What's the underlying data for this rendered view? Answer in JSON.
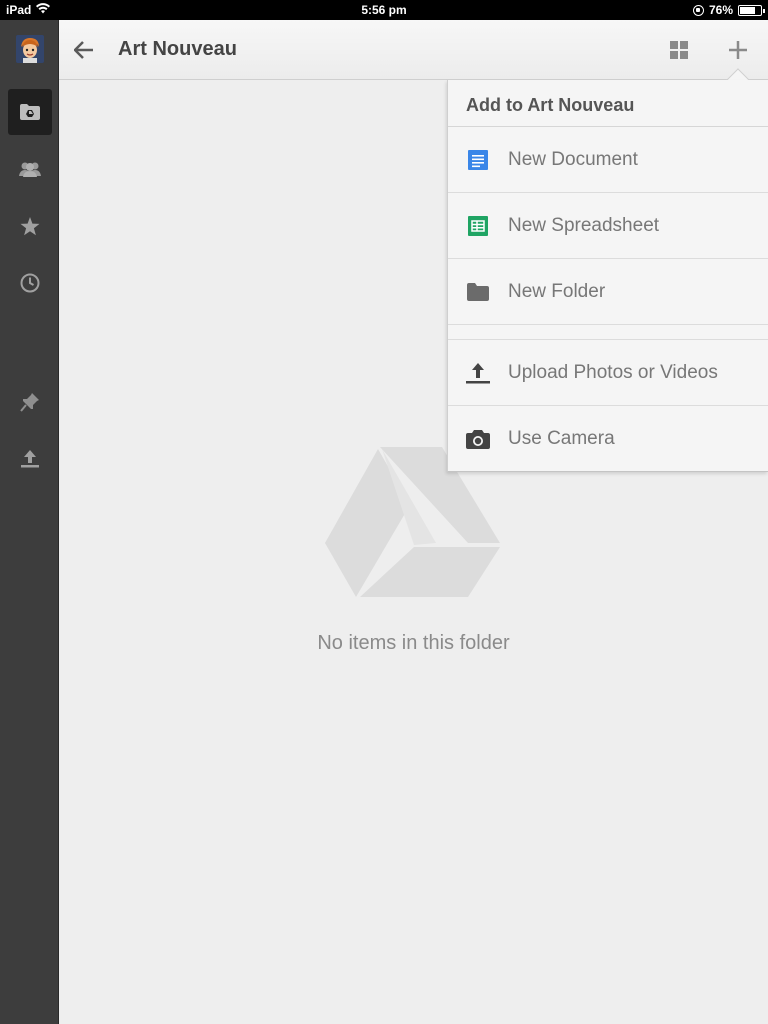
{
  "status_bar": {
    "device": "iPad",
    "time": "5:56 pm",
    "battery_percent": "76%",
    "battery_level": 0.76
  },
  "sidebar": {
    "items": [
      {
        "icon": "drive-folder-icon",
        "active": true
      },
      {
        "icon": "shared-people-icon",
        "active": false
      },
      {
        "icon": "star-icon",
        "active": false
      },
      {
        "icon": "clock-icon",
        "active": false
      },
      {
        "icon": "pin-icon",
        "active": false
      },
      {
        "icon": "upload-icon",
        "active": false
      }
    ]
  },
  "header": {
    "title": "Art Nouveau"
  },
  "menu": {
    "title": "Add to Art Nouveau",
    "items": [
      {
        "label": "New Document",
        "icon": "document-icon",
        "color": "#3a86e8"
      },
      {
        "label": "New Spreadsheet",
        "icon": "spreadsheet-icon",
        "color": "#1fa463"
      },
      {
        "label": "New Folder",
        "icon": "folder-icon",
        "color": "#6b6b6b"
      },
      {
        "label": "Upload Photos or Videos",
        "icon": "upload-icon",
        "color": "#444444"
      },
      {
        "label": "Use Camera",
        "icon": "camera-icon",
        "color": "#444444"
      }
    ]
  },
  "empty_state": {
    "message": "No items in this folder"
  }
}
